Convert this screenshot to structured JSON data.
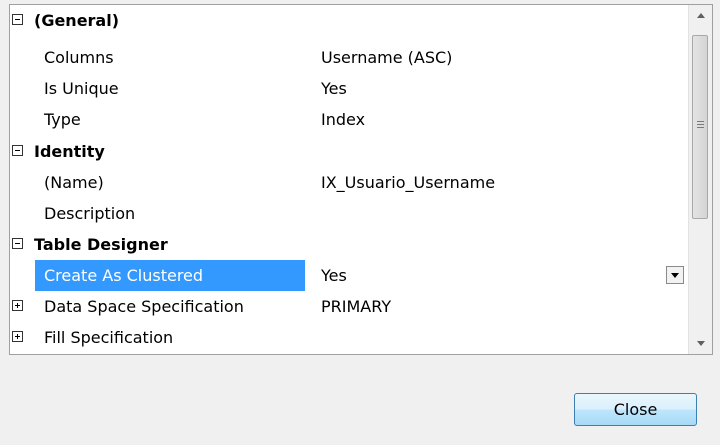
{
  "property_grid": {
    "categories": {
      "general": {
        "label": "(General)"
      },
      "identity": {
        "label": "Identity"
      },
      "table_designer": {
        "label": "Table Designer"
      }
    },
    "rows": [
      {
        "name": "Columns",
        "value": "Username (ASC)"
      },
      {
        "name": "Is Unique",
        "value": "Yes"
      },
      {
        "name": "Type",
        "value": "Index"
      },
      {
        "name": "(Name)",
        "value": "IX_Usuario_Username"
      },
      {
        "name": "Description",
        "value": ""
      },
      {
        "name": "Create As Clustered",
        "value": "Yes",
        "selected": true,
        "has_dropdown": true
      },
      {
        "name": "Data Space Specification",
        "value": "PRIMARY",
        "expandable": true
      },
      {
        "name": "Fill Specification",
        "value": "",
        "expandable": true
      }
    ],
    "selection_color": "#3399ff"
  },
  "footer": {
    "close_label": "Close"
  }
}
